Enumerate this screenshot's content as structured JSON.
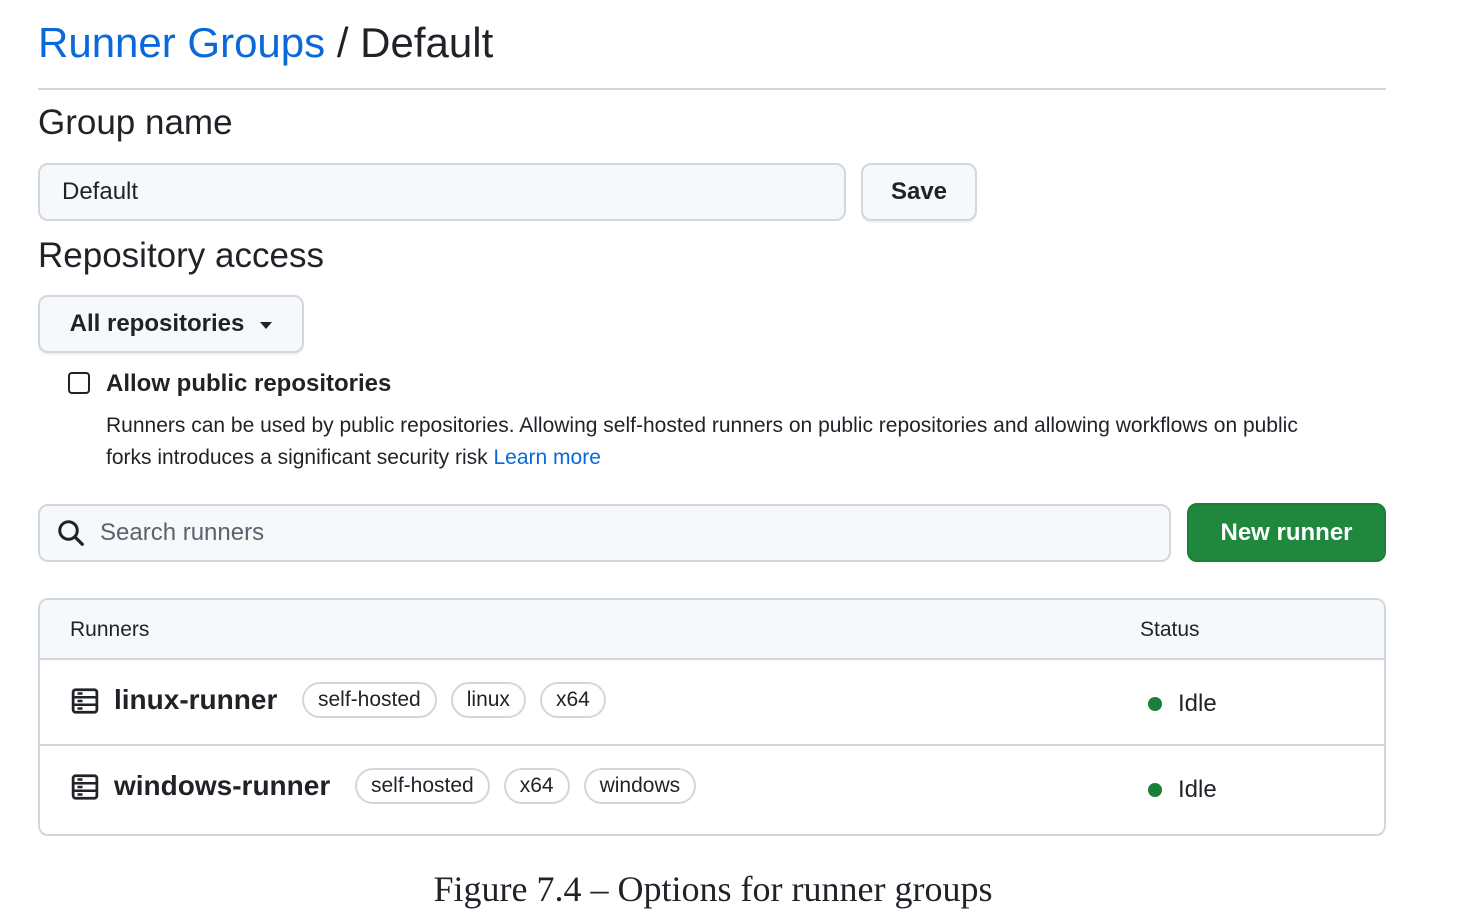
{
  "breadcrumb": {
    "parent": "Runner Groups",
    "separator": " / ",
    "current": "Default"
  },
  "group_name": {
    "heading": "Group name",
    "value": "Default",
    "save_label": "Save"
  },
  "repository_access": {
    "heading": "Repository access",
    "dropdown_value": "All repositories",
    "allow_public": {
      "checked": false,
      "label": "Allow public repositories",
      "description": "Runners can be used by public repositories. Allowing self-hosted runners on public repositories and allowing workflows on public forks introduces a significant security risk",
      "learn_more": "Learn more"
    }
  },
  "search": {
    "placeholder": "Search runners"
  },
  "new_runner_label": "New runner",
  "table": {
    "columns": [
      "Runners",
      "Status"
    ],
    "rows": [
      {
        "name": "linux-runner",
        "labels": [
          "self-hosted",
          "linux",
          "x64"
        ],
        "status": "Idle"
      },
      {
        "name": "windows-runner",
        "labels": [
          "self-hosted",
          "x64",
          "windows"
        ],
        "status": "Idle"
      }
    ]
  },
  "caption": "Figure 7.4 – Options for runner groups",
  "colors": {
    "link": "#0969da",
    "primary_button": "#1f883d",
    "status_idle": "#1a7f37"
  },
  "icons": [
    "search-icon",
    "server-icon",
    "chevron-down-icon",
    "status-dot-icon"
  ]
}
